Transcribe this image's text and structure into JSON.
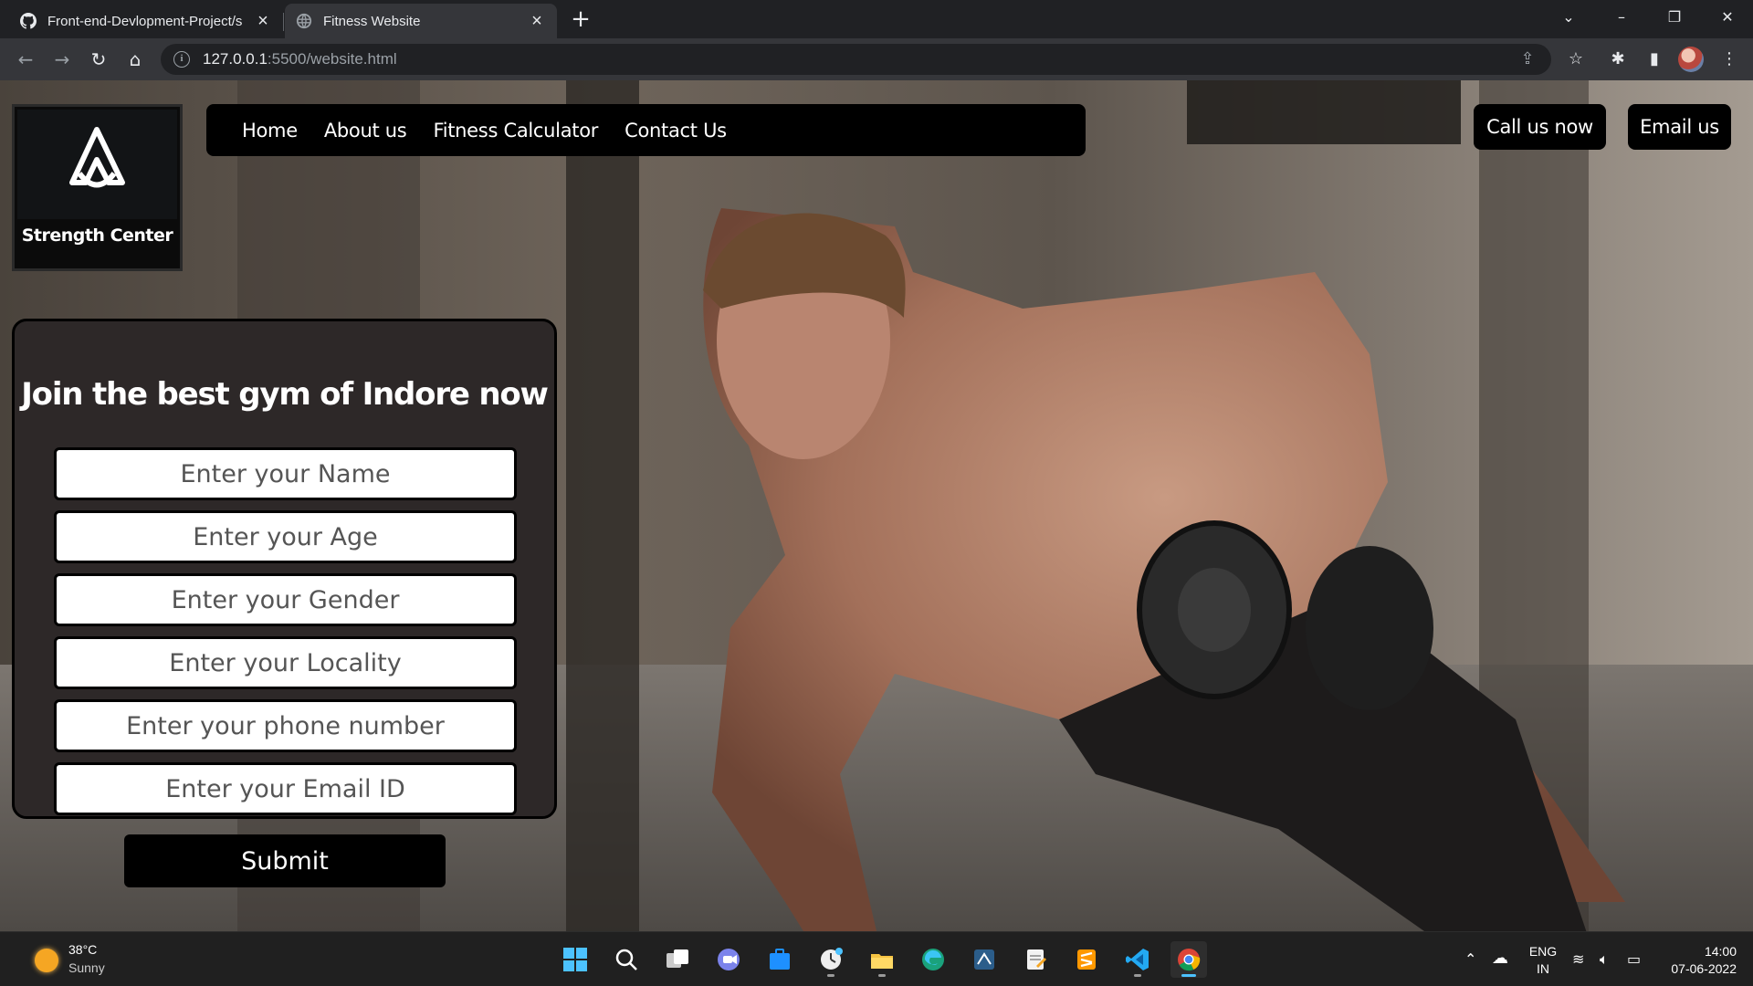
{
  "browser": {
    "tabs": [
      {
        "title": "Front-end-Devlopment-Project/s",
        "active": false,
        "icon": "github-icon"
      },
      {
        "title": "Fitness Website",
        "active": true,
        "icon": "globe-icon"
      }
    ],
    "url_host": "127.0.0.1",
    "url_rest": ":5500/website.html"
  },
  "site": {
    "brand": "Strength Center",
    "nav": [
      "Home",
      "About us",
      "Fitness Calculator",
      "Contact Us"
    ],
    "cta": {
      "call": "Call us now",
      "email": "Email us"
    },
    "form": {
      "title": "Join the best gym of Indore now",
      "fields": [
        "Enter your Name",
        "Enter your Age",
        "Enter your Gender",
        "Enter your Locality",
        "Enter your phone number",
        "Enter your Email ID"
      ],
      "submit": "Submit"
    }
  },
  "taskbar": {
    "weather": {
      "temp": "38°C",
      "condition": "Sunny"
    },
    "apps": [
      "windows-start-icon",
      "search-icon",
      "task-view-icon",
      "teams-chat-icon",
      "store-icon",
      "clock-app-icon",
      "file-explorer-icon",
      "edge-icon",
      "app-icon",
      "notepad-icon",
      "sublime-text-icon",
      "vscode-icon",
      "chrome-icon"
    ],
    "language": {
      "line1": "ENG",
      "line2": "IN"
    },
    "clock": {
      "time": "14:00",
      "date": "07-06-2022"
    }
  },
  "colors": {
    "form_bg": "#2d2828",
    "button_bg": "#000000",
    "chrome_dark": "#202124",
    "chrome_toolbar": "#35363a"
  }
}
